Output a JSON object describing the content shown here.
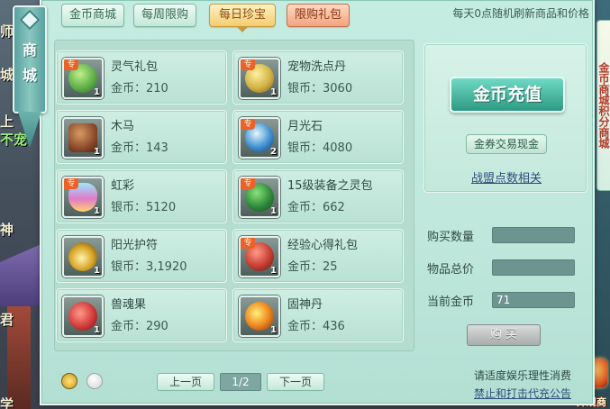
{
  "scene": {
    "labels": [
      "师",
      "上",
      "不宠",
      "神",
      "君",
      "城",
      "学"
    ]
  },
  "sidebar_title": "商城",
  "tabs": [
    {
      "label": "金币商城",
      "state": "normal"
    },
    {
      "label": "每周限购",
      "state": "normal"
    },
    {
      "label": "每日珍宝",
      "state": "active"
    },
    {
      "label": "限购礼包",
      "state": "limited"
    }
  ],
  "refresh_note": "每天0点随机刷新商品和价格",
  "items": [
    {
      "name": "灵气礼包",
      "price": "金币：210",
      "count": "1",
      "tag": "专",
      "icon": "lingqi-gift-icon",
      "color": "#5fb04a"
    },
    {
      "name": "宠物洗点丹",
      "price": "银币：3060",
      "count": "1",
      "tag": "专",
      "icon": "gold-pills-icon",
      "color": "#d2b244"
    },
    {
      "name": "木马",
      "price": "金币：143",
      "count": "1",
      "tag": "",
      "icon": "wooden-horse-icon",
      "color": "#8a4a2a"
    },
    {
      "name": "月光石",
      "price": "银币：4080",
      "count": "2",
      "tag": "专",
      "icon": "moonstone-icon",
      "color": "#3e8fd0"
    },
    {
      "name": "虹彩",
      "price": "银币：5120",
      "count": "1",
      "tag": "专",
      "icon": "rainbow-bottle-icon",
      "color": "#e07ac8"
    },
    {
      "name": "15级装备之灵包",
      "price": "金币：662",
      "count": "1",
      "tag": "专",
      "icon": "equipment-spirit-pack-icon",
      "color": "#2f8a3a"
    },
    {
      "name": "阳光护符",
      "price": "银币：3,1920",
      "count": "1",
      "tag": "",
      "icon": "sunlight-amulet-icon",
      "color": "#d9a628"
    },
    {
      "name": "经验心得礼包",
      "price": "金币：25",
      "count": "1",
      "tag": "专",
      "icon": "experience-gift-icon",
      "color": "#c63d32"
    },
    {
      "name": "兽魂果",
      "price": "金币：290",
      "count": "1",
      "tag": "",
      "icon": "beast-soul-fruit-icon",
      "color": "#d23a3a"
    },
    {
      "name": "固神丹",
      "price": "金币：436",
      "count": "1",
      "tag": "",
      "icon": "gushen-pill-icon",
      "color": "#f08a20"
    }
  ],
  "side": {
    "recharge": "金币充值",
    "voucher": "金券交易现金",
    "alliance": "战盟点数相关"
  },
  "form": {
    "qty_label": "购买数量",
    "qty_value": "",
    "total_label": "物品总价",
    "total_value": "",
    "gold_label": "当前金币",
    "gold_value": "71"
  },
  "buy_label": "购  买",
  "pagination": {
    "prev": "上一页",
    "indicator": "1/2",
    "next": "下一页"
  },
  "notices": {
    "line1": "请适度娱乐理性消费",
    "line2": "禁止和打击代充公告"
  },
  "right_tab_text": "金币商城积分商城",
  "right_icon_label": "外观商"
}
